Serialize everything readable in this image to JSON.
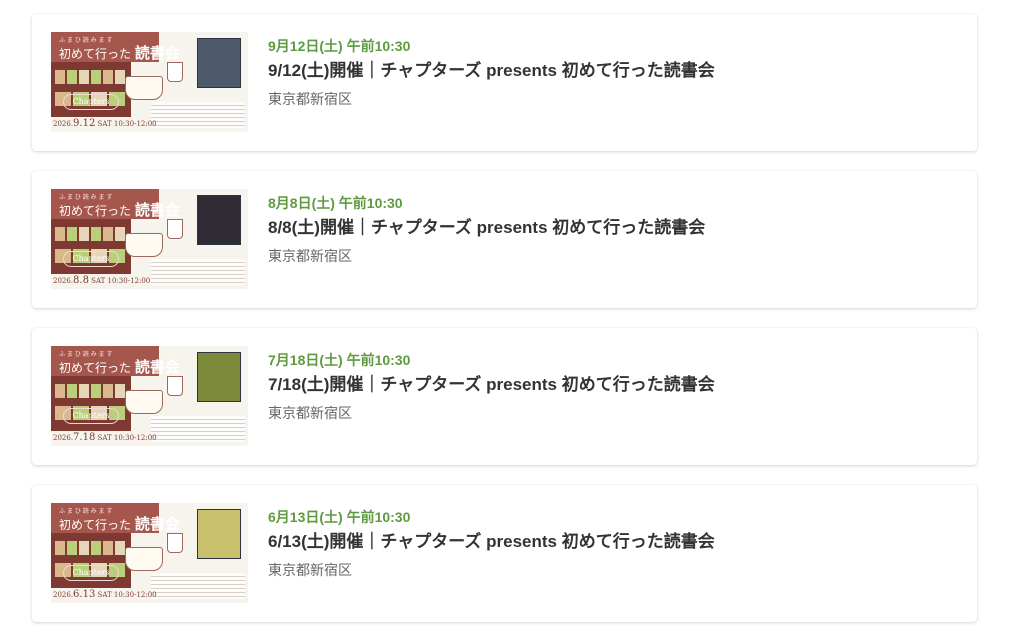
{
  "events": [
    {
      "date": "9月12日(土) 午前10:30",
      "title": "9/12(土)開催｜チャプターズ presents 初めて行った読書会",
      "location": "東京都新宿区",
      "thumb": {
        "script": "ふ ま ひ 読 み ま す",
        "heading_small": "初めて行った",
        "heading_big": "読書会",
        "logo": "Chapters",
        "date_line_prefix": "2026.",
        "date_line_day": "9.12",
        "date_line_suffix": " SAT 10:30-12:00"
      }
    },
    {
      "date": "8月8日(土) 午前10:30",
      "title": "8/8(土)開催｜チャプターズ presents 初めて行った読書会",
      "location": "東京都新宿区",
      "thumb": {
        "script": "ふ ま ひ 読 み ま す",
        "heading_small": "初めて行った",
        "heading_big": "読書会",
        "logo": "Chapters",
        "date_line_prefix": "2026.",
        "date_line_day": "8.8",
        "date_line_suffix": " SAT 10:30-12:00"
      }
    },
    {
      "date": "7月18日(土) 午前10:30",
      "title": "7/18(土)開催｜チャプターズ presents 初めて行った読書会",
      "location": "東京都新宿区",
      "thumb": {
        "script": "ふ ま ひ 読 み ま す",
        "heading_small": "初めて行った",
        "heading_big": "読書会",
        "logo": "Chapters",
        "date_line_prefix": "2026.",
        "date_line_day": "7.18",
        "date_line_suffix": " SAT 10:30-12:00"
      }
    },
    {
      "date": "6月13日(土) 午前10:30",
      "title": "6/13(土)開催｜チャプターズ presents 初めて行った読書会",
      "location": "東京都新宿区",
      "thumb": {
        "script": "ふ ま ひ 読 み ま す",
        "heading_small": "初めて行った",
        "heading_big": "読書会",
        "logo": "Chapters",
        "date_line_prefix": "2026.",
        "date_line_day": "6.13",
        "date_line_suffix": " SAT 10:30-12:00"
      }
    }
  ],
  "colors": {
    "date_green": "#5e9a3f",
    "title_text": "#333333",
    "location_text": "#666666",
    "flyer_brown": "#a5574d",
    "card_bg": "#ffffff"
  },
  "cover_colors": [
    "#4d5a6b",
    "#2f2b35",
    "#7c8a3a",
    "#c8c06a"
  ]
}
